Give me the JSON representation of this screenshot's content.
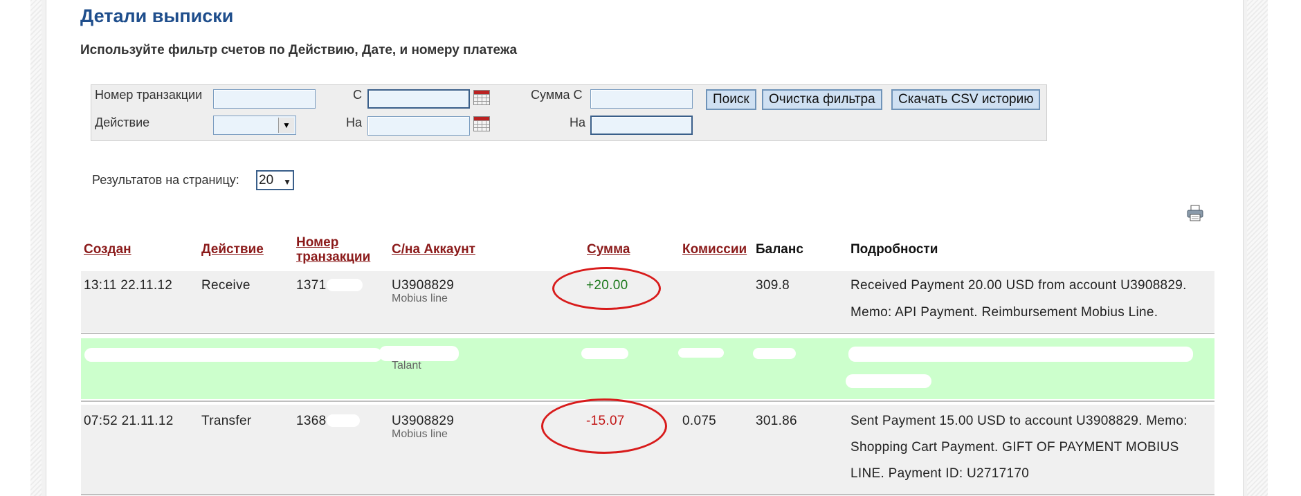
{
  "page": {
    "title": "Детали выписки",
    "subtitle": "Используйте фильтр счетов по Действию, Дате, и номеру платежа"
  },
  "filter": {
    "transaction_label": "Номер транзакции",
    "action_label": "Действие",
    "date_from_label": "С",
    "date_to_label": "На",
    "amount_from_label": "Сумма С",
    "amount_to_label": "На",
    "search_button": "Поиск",
    "clear_button": "Очистка фильтра",
    "csv_button": "Скачать CSV историю"
  },
  "results_per_page": {
    "label": "Результатов на страницу:",
    "value": "20"
  },
  "table": {
    "headers": {
      "created": "Создан",
      "action": "Действие",
      "txn_line1": "Номер",
      "txn_line2": "транзакции",
      "account": "С/на Аккаунт",
      "amount": "Сумма",
      "fees": "Комиссии",
      "balance": "Баланс",
      "details": "Подробности"
    },
    "rows": [
      {
        "created": "13:11 22.11.12",
        "action": "Receive",
        "txn": "1371",
        "account": "U3908829",
        "account_name": "Mobius line",
        "amount": "+20.00",
        "fees": "",
        "balance": "309.8",
        "details_line1": "Received Payment 20.00 USD from account U3908829.",
        "details_line2": "Memo: API Payment. Reimbursement Mobius Line."
      },
      {
        "account_name": "Talant"
      },
      {
        "created": "07:52 21.11.12",
        "action": "Transfer",
        "txn": "1368",
        "account": "U3908829",
        "account_name": "Mobius line",
        "amount": "-15.07",
        "fees": "0.075",
        "balance": "301.86",
        "details_line1": "Sent Payment 15.00 USD to account U3908829. Memo:",
        "details_line2": "Shopping Cart Payment. GIFT OF PAYMENT MOBIUS",
        "details_line3": "LINE. Payment ID: U2717170"
      }
    ]
  },
  "colors": {
    "title": "#1f4e8c",
    "header_link": "#8b1a1a",
    "positive": "#1e7a1e",
    "negative": "#c21818",
    "highlight_row": "#ccffcc",
    "annotation": "#d81b1b"
  }
}
